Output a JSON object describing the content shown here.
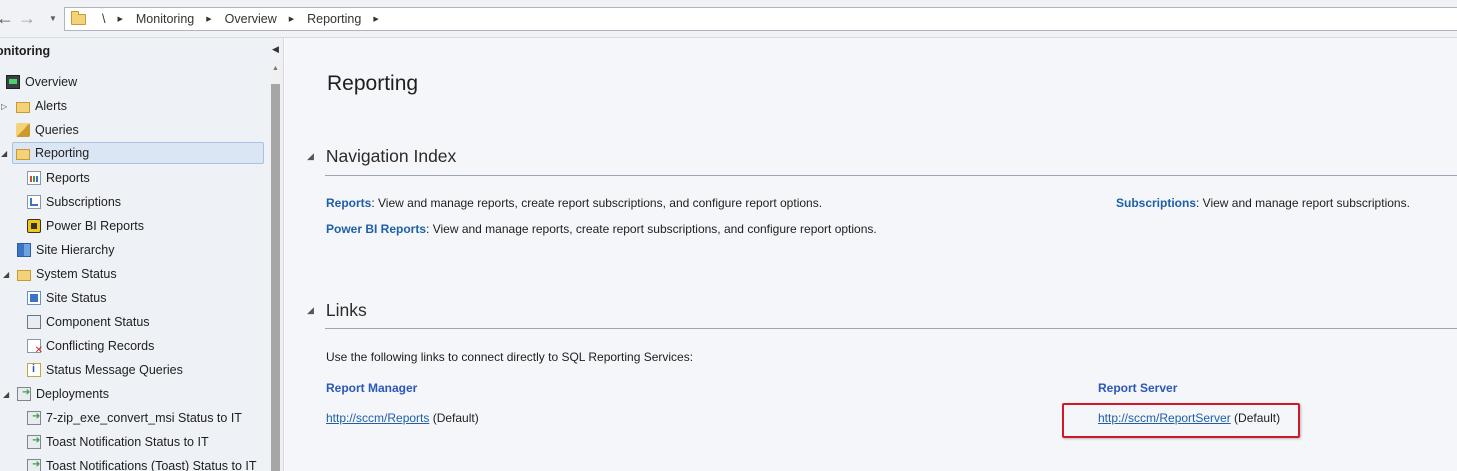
{
  "address_bar": {
    "root": "\\",
    "breadcrumbs": [
      "Monitoring",
      "Overview",
      "Reporting"
    ]
  },
  "sidebar": {
    "title": "Monitoring",
    "title_visible": "onitoring",
    "items": [
      {
        "label": "Overview",
        "icon": "monitor-icon"
      },
      {
        "label": "Alerts",
        "icon": "folder-icon"
      },
      {
        "label": "Queries",
        "icon": "queries-icon"
      },
      {
        "label": "Reporting",
        "icon": "folder-icon"
      },
      {
        "label": "Reports",
        "icon": "reports-icon"
      },
      {
        "label": "Subscriptions",
        "icon": "subscriptions-icon"
      },
      {
        "label": "Power BI Reports",
        "icon": "power-bi-icon"
      },
      {
        "label": "Site Hierarchy",
        "icon": "site-hierarchy-icon"
      },
      {
        "label": "System Status",
        "icon": "folder-icon"
      },
      {
        "label": "Site Status",
        "icon": "site-status-icon"
      },
      {
        "label": "Component Status",
        "icon": "component-status-icon"
      },
      {
        "label": "Conflicting Records",
        "icon": "conflicting-records-icon"
      },
      {
        "label": "Status Message Queries",
        "icon": "status-message-icon"
      },
      {
        "label": "Deployments",
        "icon": "deployments-icon"
      },
      {
        "label": "7-zip_exe_convert_msi Status to IT",
        "icon": "deployment-item-icon"
      },
      {
        "label": "Toast Notification Status to IT",
        "icon": "deployment-item-icon"
      },
      {
        "label": "Toast Notifications (Toast) Status to IT",
        "icon": "deployment-item-icon"
      }
    ]
  },
  "main": {
    "title": "Reporting",
    "navigation_index": {
      "heading": "Navigation Index",
      "entries": [
        {
          "link": "Reports",
          "text": ": View and manage reports, create report subscriptions, and configure report options."
        },
        {
          "link": "Power BI Reports",
          "text": ": View and manage reports, create report subscriptions, and configure report options."
        },
        {
          "link": "Subscriptions",
          "text": ": View and manage report subscriptions."
        }
      ]
    },
    "links": {
      "heading": "Links",
      "intro": "Use the following links to connect directly to SQL Reporting Services:",
      "report_manager": {
        "heading": "Report Manager",
        "url": "http://sccm/Reports",
        "suffix": " (Default)"
      },
      "report_server": {
        "heading": "Report Server",
        "url": "http://sccm/ReportServer",
        "suffix": " (Default)"
      }
    }
  },
  "colors": {
    "link": "#1e5fa8",
    "column_heading": "#2b57b8",
    "highlight_box": "#d0182a",
    "selected_item": "#dbe6f4"
  }
}
